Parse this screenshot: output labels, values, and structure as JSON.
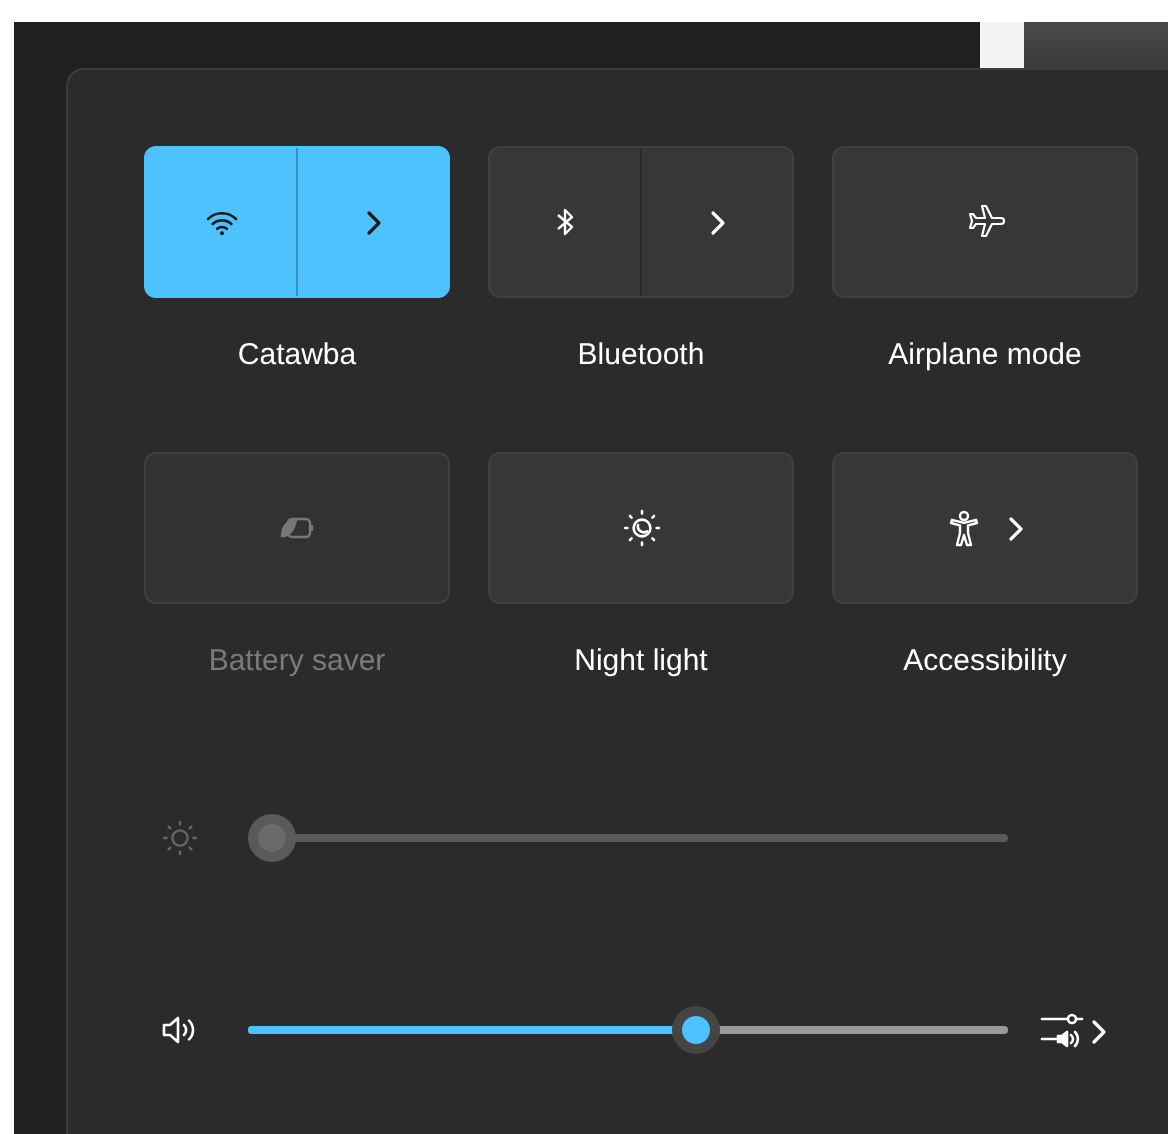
{
  "tiles": [
    {
      "kind": "split",
      "label": "Catawba",
      "on": true,
      "disabled": false
    },
    {
      "kind": "split",
      "label": "Bluetooth",
      "on": false,
      "disabled": false
    },
    {
      "kind": "single",
      "label": "Airplane mode",
      "on": false,
      "disabled": false
    },
    {
      "kind": "single",
      "label": "Battery saver",
      "on": false,
      "disabled": true
    },
    {
      "kind": "single",
      "label": "Night light",
      "on": false,
      "disabled": false
    },
    {
      "kind": "expand",
      "label": "Accessibility",
      "on": false,
      "disabled": false
    }
  ],
  "sliders": [
    {
      "kind": "brightness",
      "level": 0,
      "disabled": true
    },
    {
      "kind": "volume",
      "level": 0.59,
      "disabled": false
    }
  ]
}
